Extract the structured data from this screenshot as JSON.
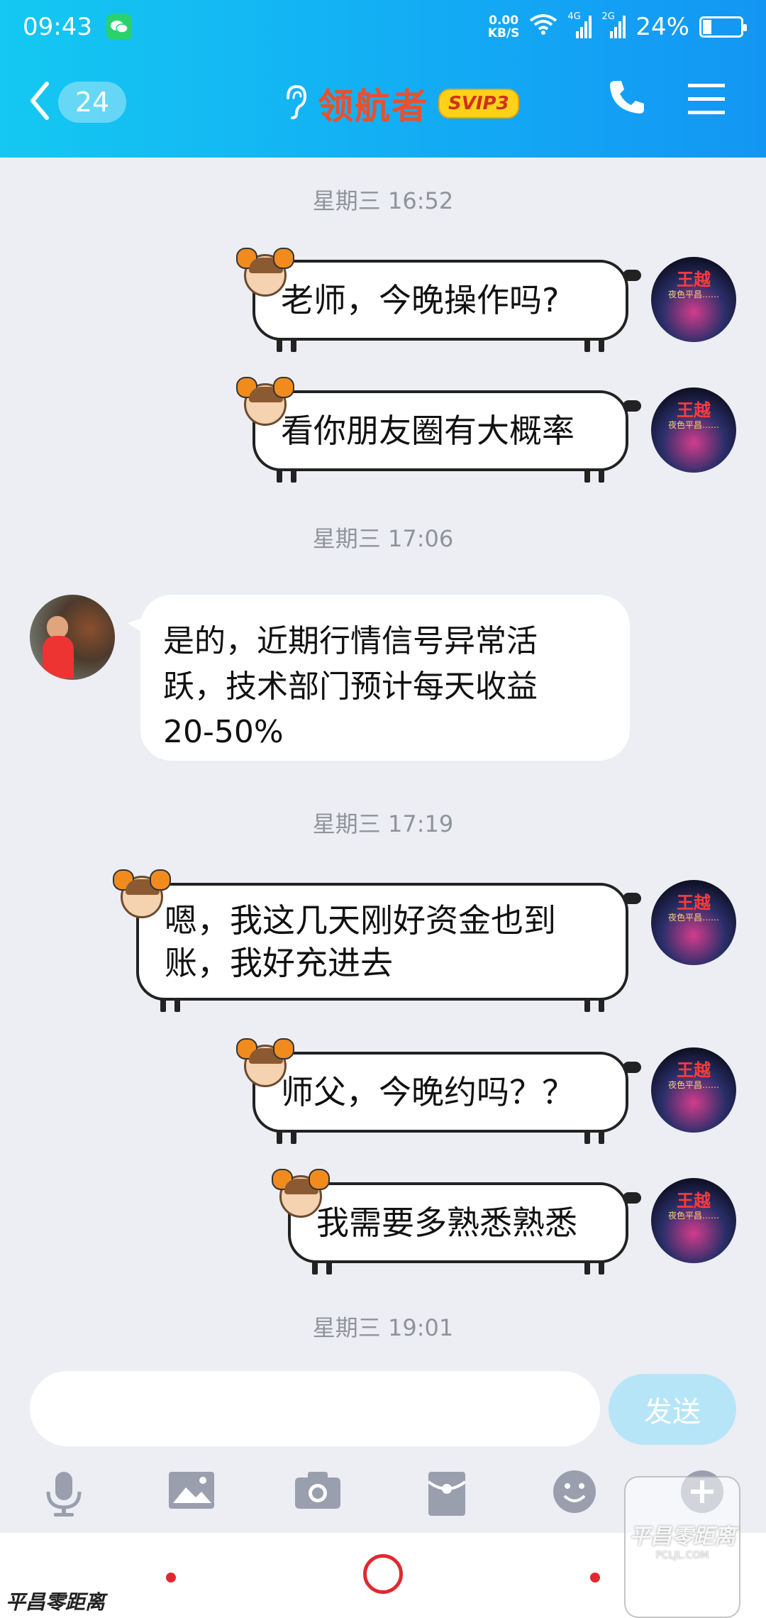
{
  "status_bar": {
    "time": "09:43",
    "net_speed": "0.00",
    "net_unit": "KB/S",
    "signal_1": "4G",
    "signal_2": "2G",
    "battery": "24%",
    "battery_fraction": 0.24
  },
  "header": {
    "unread_count": "24",
    "contact_name": "领航者",
    "vip_badge": "SVIP3",
    "accent_color": "#13aaf4",
    "name_color": "#e8502e"
  },
  "messages": {
    "ts1": "星期三 16:52",
    "m1": "老师，今晚操作吗?",
    "m2": "看你朋友圈有大概率",
    "ts2": "星期三 17:06",
    "m3_line1": "是的，近期行情信号异常活",
    "m3_line2": "跃，技术部门预计每天收益",
    "m3_line3": "20-50%",
    "ts3": "星期三 17:19",
    "m4_line1": "嗯，我这几天刚好资金也到",
    "m4_line2": "账，我好充进去",
    "m5": "师父，今晚约吗？？",
    "m6": "我需要多熟悉熟悉",
    "ts4": "星期三 19:01"
  },
  "self_avatar": {
    "name": "王越",
    "subtitle": "夜色平昌……"
  },
  "input": {
    "value": "",
    "send_label": "发送"
  },
  "toolbar": {
    "icons": [
      "microphone-icon",
      "image-icon",
      "camera-icon",
      "red-packet-icon",
      "emoji-icon",
      "plus-icon"
    ]
  },
  "watermark": {
    "main": "平昌零距离",
    "sub": "PCLJL.COM"
  }
}
